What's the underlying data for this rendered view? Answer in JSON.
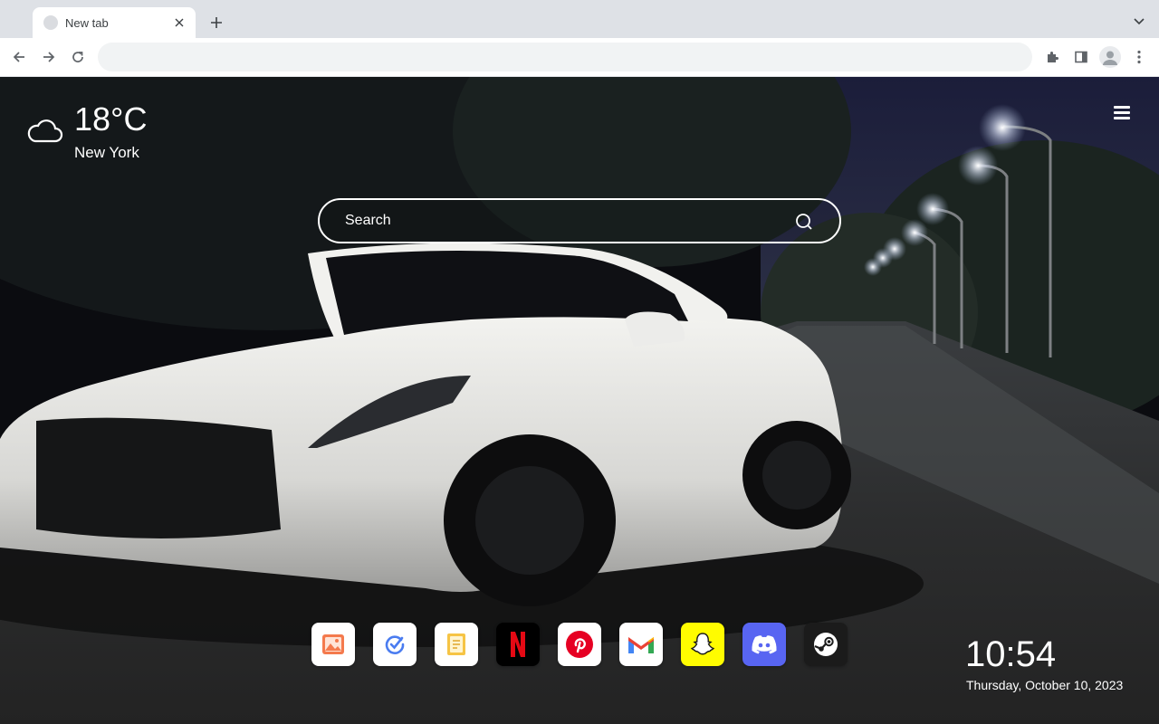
{
  "browser": {
    "tab_title": "New tab",
    "omnibox_value": "",
    "icons": {
      "back": "back-arrow-icon",
      "forward": "forward-arrow-icon",
      "reload": "reload-icon",
      "extensions": "puzzle-icon",
      "side_panel": "side-panel-icon",
      "profile": "profile-avatar-icon",
      "menu": "three-dot-menu-icon"
    }
  },
  "weather": {
    "temperature": "18°C",
    "city": "New York",
    "icon": "cloud-icon"
  },
  "search": {
    "placeholder": "Search"
  },
  "shortcuts": [
    {
      "name": "Photos",
      "icon": "photo-icon",
      "bg": "#ffffff"
    },
    {
      "name": "Tasks",
      "icon": "check-circle-icon",
      "bg": "#ffffff"
    },
    {
      "name": "Notes",
      "icon": "notes-icon",
      "bg": "#ffffff"
    },
    {
      "name": "Netflix",
      "icon": "netflix-icon",
      "bg": "#000000"
    },
    {
      "name": "Pinterest",
      "icon": "pinterest-icon",
      "bg": "#ffffff"
    },
    {
      "name": "Gmail",
      "icon": "gmail-icon",
      "bg": "#ffffff"
    },
    {
      "name": "Snapchat",
      "icon": "snapchat-icon",
      "bg": "#fffc00"
    },
    {
      "name": "Discord",
      "icon": "discord-icon",
      "bg": "#5865f2"
    },
    {
      "name": "Steam",
      "icon": "steam-icon",
      "bg": "#1b1b1b"
    }
  ],
  "clock": {
    "time": "10:54",
    "date": "Thursday, October 10, 2023"
  }
}
